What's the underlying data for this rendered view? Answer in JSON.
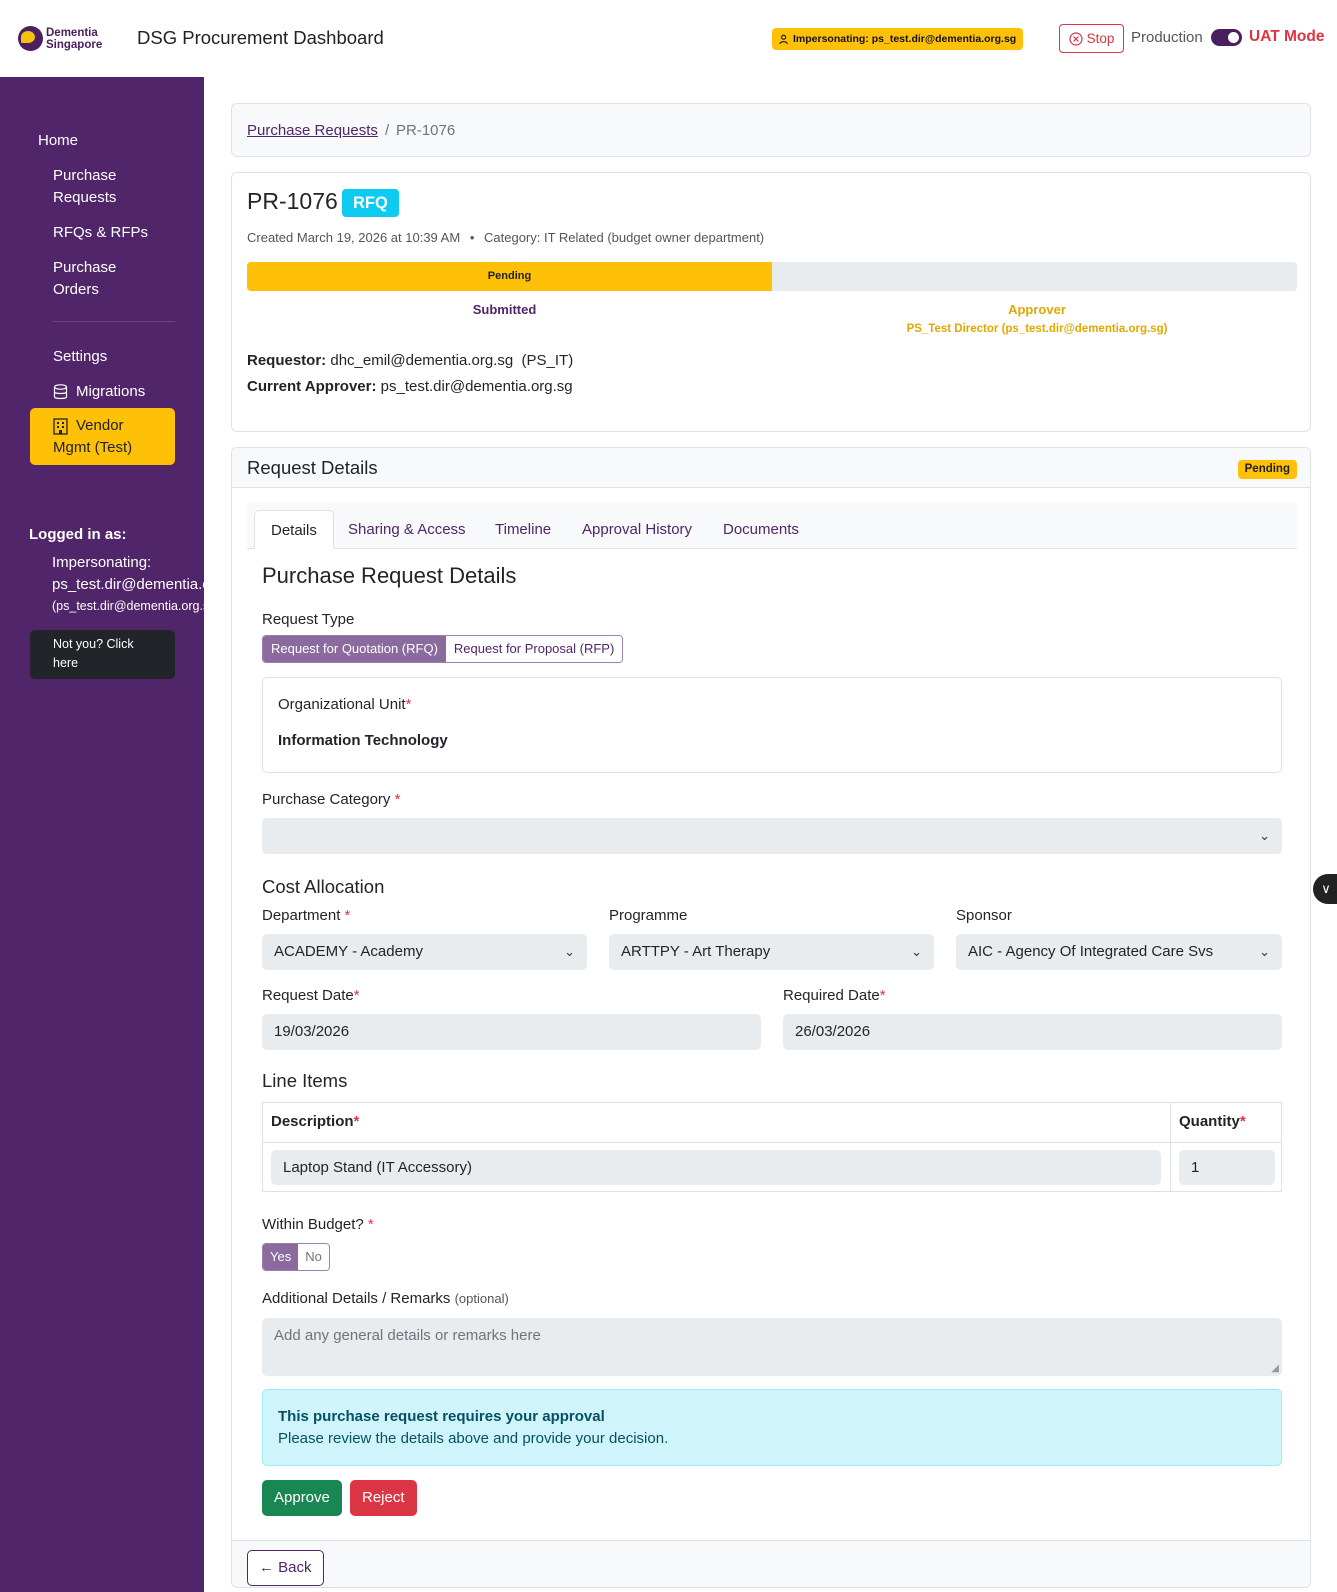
{
  "header": {
    "logo_line1": "Dementia",
    "logo_line2": "Singapore",
    "app_title": "DSG Procurement Dashboard",
    "impersonating_badge": "Impersonating: ps_test.dir@dementia.org.sg",
    "stop_label": "Stop",
    "env_label": "Production",
    "mode_label": "UAT Mode",
    "mode_toggle_on": true
  },
  "sidebar": {
    "home": "Home",
    "purchase_requests_1": "Purchase",
    "purchase_requests_2": "Requests",
    "rfqs": "RFQs & RFPs",
    "purchase_orders_1": "Purchase",
    "purchase_orders_2": "Orders",
    "settings": "Settings",
    "migrations": "Migrations",
    "vendor_1": "Vendor",
    "vendor_2": "Mgmt (Test)",
    "logged_in_as": "Logged in as:",
    "impersonating_label": "Impersonating:",
    "impersonating_user": "ps_test.dir@dementia.org.sg",
    "impersonating_sub": "(ps_test.dir@dementia.org.sg)",
    "not_you_1": "Not you? Click",
    "not_you_2": "here"
  },
  "breadcrumb": {
    "parent": "Purchase Requests",
    "separator": "/",
    "current": "PR-1076"
  },
  "summary": {
    "pr_id": "PR-1076",
    "type_badge": "RFQ",
    "created": "Created March 19, 2026 at 10:39 AM",
    "bullet": "•",
    "category": "Category: IT Related (budget owner department)",
    "progress_label": "Pending",
    "progress_fraction": 0.5,
    "step1": "Submitted",
    "step2": "Approver",
    "step2_sub": "PS_Test Director (ps_test.dir@dementia.org.sg)",
    "requestor_label": "Requestor:",
    "requestor_value": "dhc_emil@dementia.org.sg  (PS_IT)",
    "approver_label": "Current Approver:",
    "approver_value": "ps_test.dir@dementia.org.sg"
  },
  "details": {
    "header": "Request Details",
    "status_badge": "Pending",
    "tabs": [
      "Details",
      "Sharing & Access",
      "Timeline",
      "Approval History",
      "Documents"
    ],
    "section_title": "Purchase Request Details",
    "request_type_label": "Request Type",
    "request_type_options": [
      "Request for Quotation (RFQ)",
      "Request for Proposal (RFP)"
    ],
    "org_unit_label": "Organizational Unit",
    "org_unit_value": "Information Technology",
    "purchase_category_label": "Purchase Category",
    "purchase_category_value": "",
    "cost_allocation_title": "Cost Allocation",
    "department_label": "Department",
    "department_value": "ACADEMY - Academy",
    "programme_label": "Programme",
    "programme_value": "ARTTPY - Art Therapy",
    "sponsor_label": "Sponsor",
    "sponsor_value": "AIC - Agency Of Integrated Care Svs",
    "request_date_label": "Request Date",
    "request_date_value": "19/03/2026",
    "required_date_label": "Required Date",
    "required_date_value": "26/03/2026",
    "line_items_title": "Line Items",
    "col_description": "Description",
    "col_quantity": "Quantity",
    "line_items": [
      {
        "description": "Laptop Stand (IT Accessory)",
        "quantity": "1"
      }
    ],
    "within_budget_label": "Within Budget?",
    "within_budget_options": [
      "Yes",
      "No"
    ],
    "remarks_label": "Additional Details / Remarks",
    "remarks_optional": "(optional)",
    "remarks_placeholder": "Add any general details or remarks here",
    "alert_title": "This purchase request requires your approval",
    "alert_body": "Please review the details above and provide your decision.",
    "approve_label": "Approve",
    "reject_label": "Reject",
    "back_label": "← Back",
    "required_mark": "*"
  },
  "colors": {
    "sidebar": "#51256a",
    "accent_yellow": "#ffc107",
    "info_badge": "#0dcaf0",
    "approve": "#198754",
    "reject": "#dc3545"
  }
}
